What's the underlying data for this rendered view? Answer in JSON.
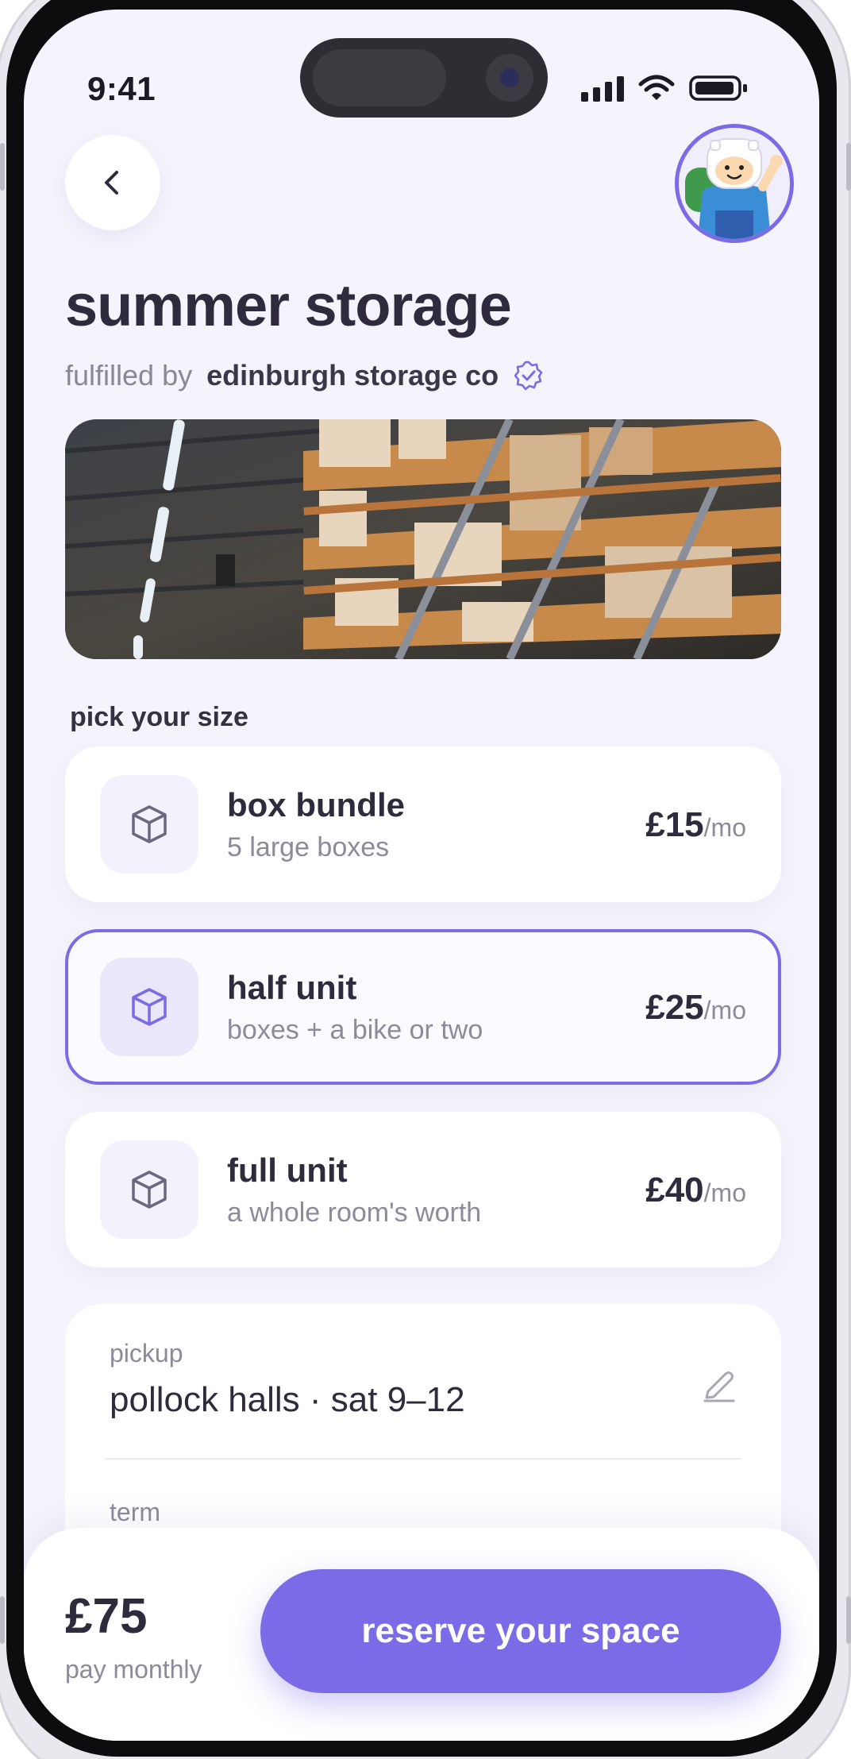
{
  "status_bar": {
    "time": "9:41"
  },
  "header": {
    "back_icon": "chevron-left-icon",
    "title": "summer storage",
    "fulfilled_label": "fulfilled by",
    "company": "edinburgh storage co",
    "verified_icon": "verified-badge-icon"
  },
  "section_label": "pick your size",
  "options": [
    {
      "name": "box bundle",
      "desc": "5 large boxes",
      "price": "£15",
      "unit": "/mo",
      "selected": false
    },
    {
      "name": "half unit",
      "desc": "boxes + a bike or two",
      "price": "£25",
      "unit": "/mo",
      "selected": true
    },
    {
      "name": "full unit",
      "desc": "a whole room's worth",
      "price": "£40",
      "unit": "/mo",
      "selected": false
    }
  ],
  "details": {
    "pickup_label": "pickup",
    "pickup_value": "pollock halls · sat 9–12",
    "term_label": "term"
  },
  "footer": {
    "total": "£75",
    "total_sub": "pay monthly",
    "cta": "reserve your space"
  },
  "colors": {
    "accent": "#7b6be6",
    "background": "#f5f3fb",
    "text": "#2f2b3d",
    "muted": "#8e8a99"
  }
}
